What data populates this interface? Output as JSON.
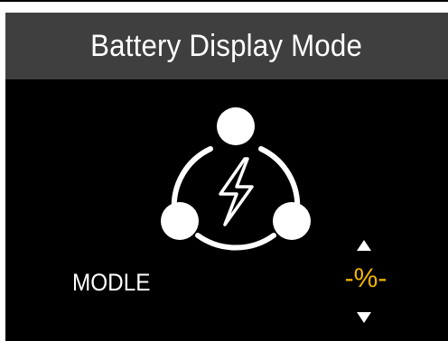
{
  "screen": {
    "title": "Battery Display Mode",
    "icon": "battery-mode-cycle-lightning-icon",
    "setting": {
      "label": "MODLE",
      "value": "-%-",
      "value_color": "#f2b400",
      "up_icon": "triangle-up-icon",
      "down_icon": "triangle-down-icon"
    }
  },
  "colors": {
    "background": "#000000",
    "title_bar": "#3f3f3f",
    "text": "#ffffff",
    "accent": "#f2b400"
  }
}
